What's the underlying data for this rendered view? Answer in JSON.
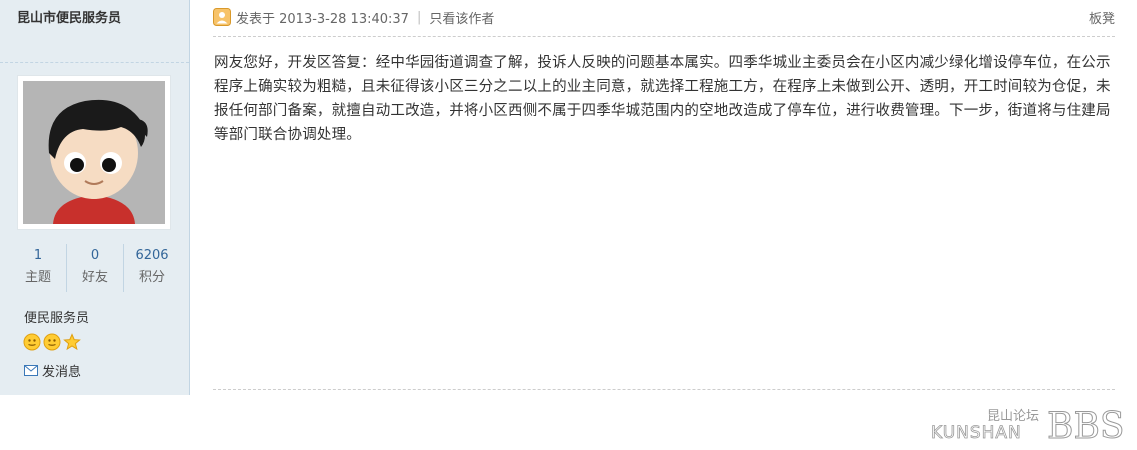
{
  "author": {
    "name": "昆山市便民服务员"
  },
  "stats": [
    {
      "value": "1",
      "label": "主题"
    },
    {
      "value": "0",
      "label": "好友"
    },
    {
      "value": "6206",
      "label": "积分"
    }
  ],
  "user_group": "便民服务员",
  "pm_label": "发消息",
  "post": {
    "posted_at": "发表于 2013-3-28 13:40:37",
    "author_only_label": "只看该作者",
    "floor_label": "板凳",
    "body": "网友您好，开发区答复：经中华园街道调查了解，投诉人反映的问题基本属实。四季华城业主委员会在小区内减少绿化增设停车位，在公示程序上确实较为粗糙，且未征得该小区三分之二以上的业主同意，就选择工程施工方，在程序上未做到公开、透明，开工时间较为仓促，未报任何部门备案，就擅自动工改造，并将小区西侧不属于四季华城范围内的空地改造成了停车位，进行收费管理。下一步，街道将与住建局等部门联合协调处理。"
  },
  "logo": {
    "top": "昆山论坛",
    "bottom": "KUNSHAN",
    "mark": "BBS"
  },
  "colors": {
    "sidebar_bg": "#e5edf2",
    "link": "#336699",
    "star": "#ffcc33"
  }
}
